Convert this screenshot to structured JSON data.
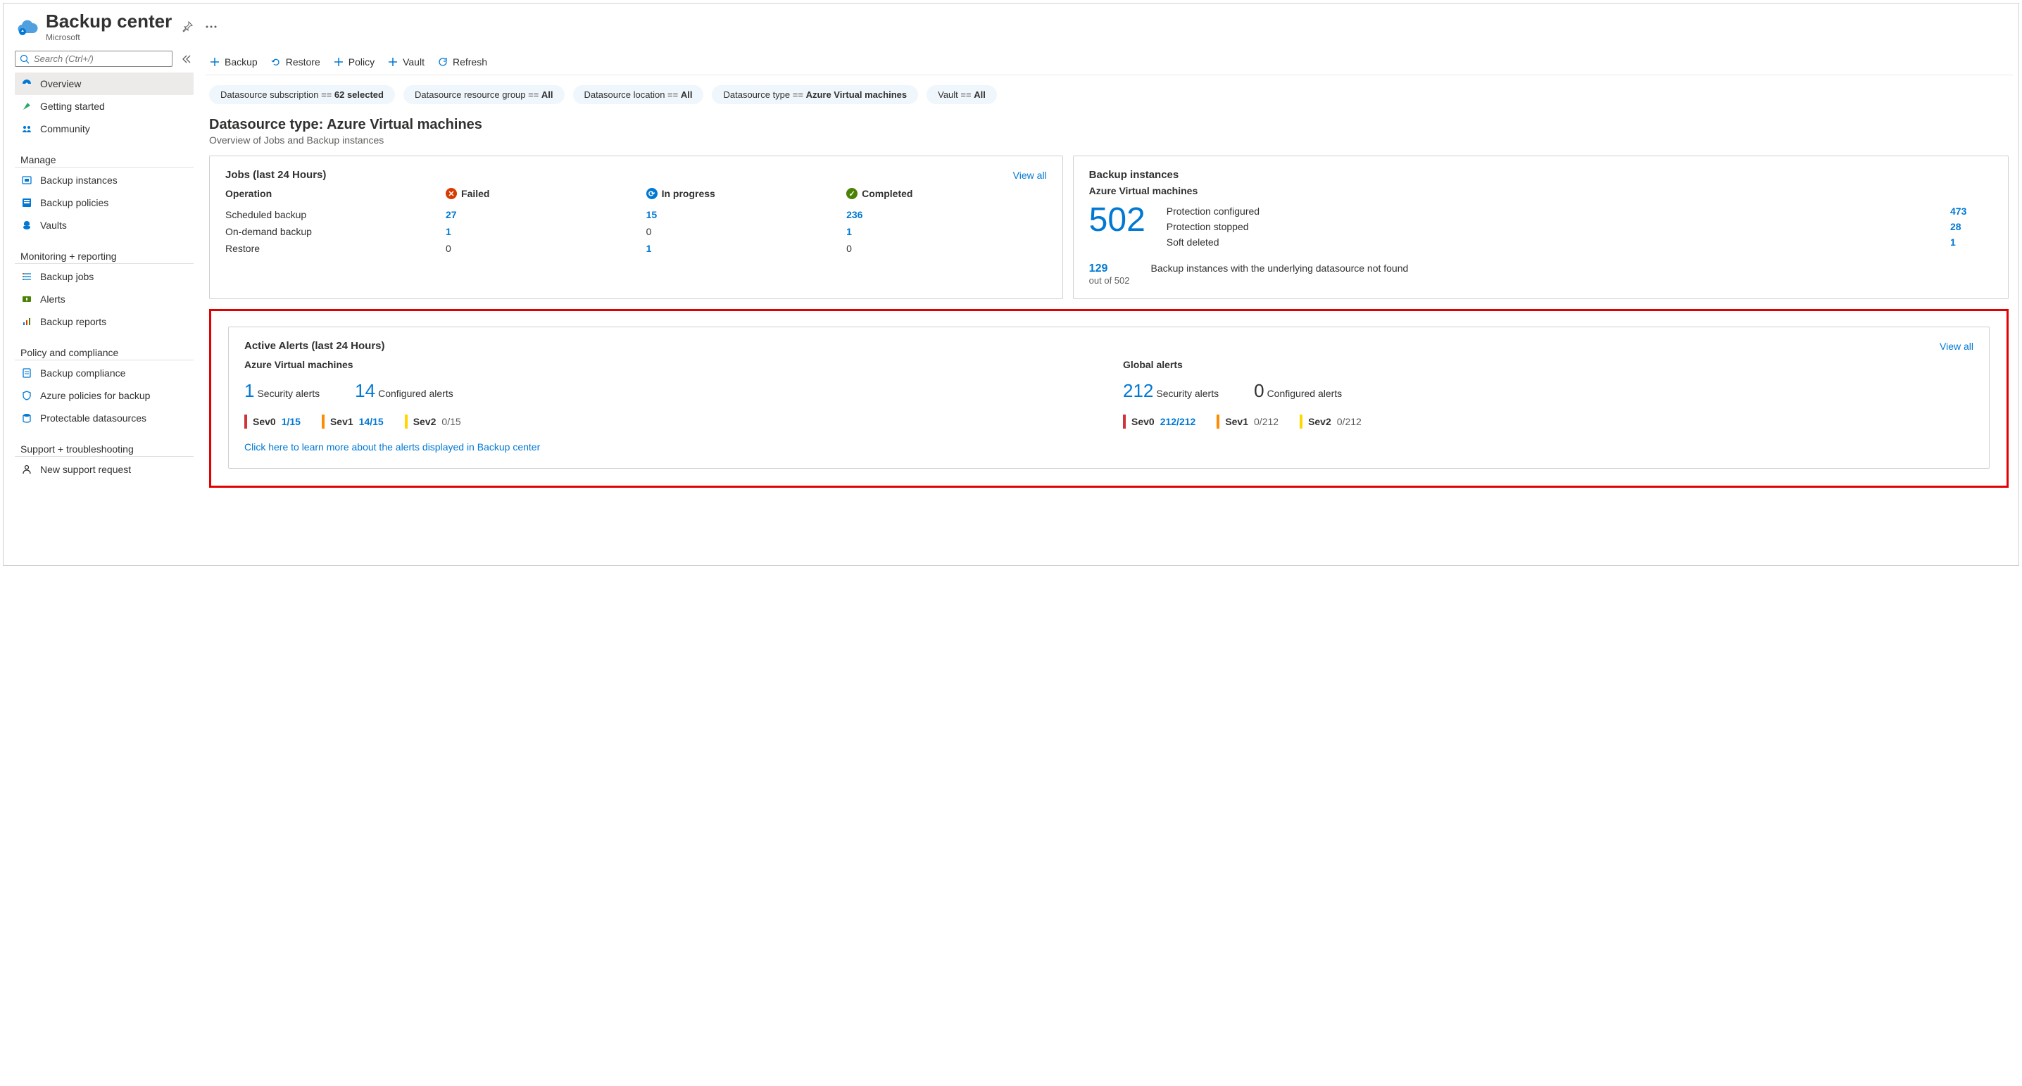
{
  "header": {
    "title": "Backup center",
    "sub": "Microsoft"
  },
  "search": {
    "placeholder": "Search (Ctrl+/)"
  },
  "nav": {
    "top": [
      {
        "label": "Overview"
      },
      {
        "label": "Getting started"
      },
      {
        "label": "Community"
      }
    ],
    "groups": [
      {
        "title": "Manage",
        "items": [
          {
            "label": "Backup instances"
          },
          {
            "label": "Backup policies"
          },
          {
            "label": "Vaults"
          }
        ]
      },
      {
        "title": "Monitoring + reporting",
        "items": [
          {
            "label": "Backup jobs"
          },
          {
            "label": "Alerts"
          },
          {
            "label": "Backup reports"
          }
        ]
      },
      {
        "title": "Policy and compliance",
        "items": [
          {
            "label": "Backup compliance"
          },
          {
            "label": "Azure policies for backup"
          },
          {
            "label": "Protectable datasources"
          }
        ]
      },
      {
        "title": "Support + troubleshooting",
        "items": [
          {
            "label": "New support request"
          }
        ]
      }
    ]
  },
  "cmd": {
    "backup": "Backup",
    "restore": "Restore",
    "policy": "Policy",
    "vault": "Vault",
    "refresh": "Refresh"
  },
  "pills": {
    "sub_prefix": "Datasource subscription == ",
    "sub_val": "62 selected",
    "rg_prefix": "Datasource resource group == ",
    "rg_val": "All",
    "loc_prefix": "Datasource location == ",
    "loc_val": "All",
    "type_prefix": "Datasource type == ",
    "type_val": "Azure Virtual machines",
    "vault_prefix": "Vault == ",
    "vault_val": "All"
  },
  "section": {
    "title": "Datasource type: Azure Virtual machines",
    "sub": "Overview of Jobs and Backup instances"
  },
  "jobs": {
    "title": "Jobs (last 24 Hours)",
    "viewall": "View all",
    "head_operation": "Operation",
    "head_failed": "Failed",
    "head_progress": "In progress",
    "head_completed": "Completed",
    "rows": [
      {
        "op": "Scheduled backup",
        "failed": "27",
        "progress": "15",
        "completed": "236"
      },
      {
        "op": "On-demand backup",
        "failed": "1",
        "progress": "0",
        "completed": "1"
      },
      {
        "op": "Restore",
        "failed": "0",
        "progress": "1",
        "completed": "0"
      }
    ]
  },
  "instances": {
    "title": "Backup instances",
    "subtitle": "Azure Virtual machines",
    "total": "502",
    "rows": [
      {
        "lbl": "Protection configured",
        "val": "473"
      },
      {
        "lbl": "Protection stopped",
        "val": "28"
      },
      {
        "lbl": "Soft deleted",
        "val": "1"
      }
    ],
    "foot_num": "129",
    "foot_sub": "out of 502",
    "foot_text": "Backup instances with the underlying datasource not found"
  },
  "alerts": {
    "title": "Active Alerts (last 24 Hours)",
    "viewall": "View all",
    "col1": {
      "title": "Azure Virtual machines",
      "m1_num": "1",
      "m1_lbl": "Security alerts",
      "m2_num": "14",
      "m2_lbl": "Configured alerts",
      "sev0_lbl": "Sev0",
      "sev0_val": "1/15",
      "sev1_lbl": "Sev1",
      "sev1_val": "14/15",
      "sev2_lbl": "Sev2",
      "sev2_val": "0/15"
    },
    "col2": {
      "title": "Global alerts",
      "m1_num": "212",
      "m1_lbl": "Security alerts",
      "m2_num": "0",
      "m2_lbl": "Configured alerts",
      "sev0_lbl": "Sev0",
      "sev0_val": "212/212",
      "sev1_lbl": "Sev1",
      "sev1_val": "0/212",
      "sev2_lbl": "Sev2",
      "sev2_val": "0/212"
    },
    "link": "Click here to learn more about the alerts displayed in Backup center"
  }
}
